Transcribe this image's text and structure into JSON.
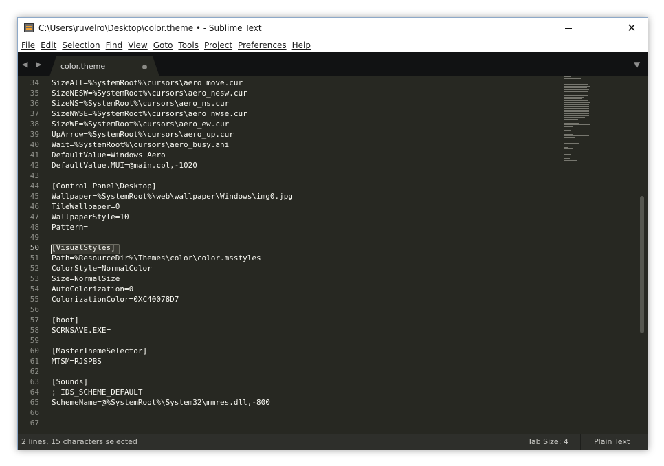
{
  "window": {
    "title": "C:\\Users\\ruvelro\\Desktop\\color.theme • - Sublime Text",
    "close_glyph": "✕"
  },
  "menu": [
    "File",
    "Edit",
    "Selection",
    "Find",
    "View",
    "Goto",
    "Tools",
    "Project",
    "Preferences",
    "Help"
  ],
  "tabbar": {
    "nav": "◀ ▶",
    "dropdown": "▼",
    "tabs": [
      {
        "label": "color.theme",
        "dirty": true
      }
    ]
  },
  "editor": {
    "current_line": 50,
    "lines": [
      {
        "no": "34",
        "text": "SizeAll=%SystemRoot%\\cursors\\aero_move.cur"
      },
      {
        "no": "35",
        "text": "SizeNESW=%SystemRoot%\\cursors\\aero_nesw.cur"
      },
      {
        "no": "36",
        "text": "SizeNS=%SystemRoot%\\cursors\\aero_ns.cur"
      },
      {
        "no": "37",
        "text": "SizeNWSE=%SystemRoot%\\cursors\\aero_nwse.cur"
      },
      {
        "no": "38",
        "text": "SizeWE=%SystemRoot%\\cursors\\aero_ew.cur"
      },
      {
        "no": "39",
        "text": "UpArrow=%SystemRoot%\\cursors\\aero_up.cur"
      },
      {
        "no": "40",
        "text": "Wait=%SystemRoot%\\cursors\\aero_busy.ani"
      },
      {
        "no": "41",
        "text": "DefaultValue=Windows Aero"
      },
      {
        "no": "42",
        "text": "DefaultValue.MUI=@main.cpl,-1020"
      },
      {
        "no": "43",
        "text": ""
      },
      {
        "no": "44",
        "text": "[Control Panel\\Desktop]"
      },
      {
        "no": "45",
        "text": "Wallpaper=%SystemRoot%\\web\\wallpaper\\Windows\\img0.jpg"
      },
      {
        "no": "46",
        "text": "TileWallpaper=0"
      },
      {
        "no": "47",
        "text": "WallpaperStyle=10"
      },
      {
        "no": "48",
        "text": "Pattern="
      },
      {
        "no": "49",
        "text": ""
      },
      {
        "no": "50",
        "text": "[VisualStyles]"
      },
      {
        "no": "51",
        "text": "Path=%ResourceDir%\\Themes\\color\\color.msstyles"
      },
      {
        "no": "52",
        "text": "ColorStyle=NormalColor"
      },
      {
        "no": "53",
        "text": "Size=NormalSize"
      },
      {
        "no": "54",
        "text": "AutoColorization=0"
      },
      {
        "no": "55",
        "text": "ColorizationColor=0XC40078D7"
      },
      {
        "no": "56",
        "text": ""
      },
      {
        "no": "57",
        "text": "[boot]"
      },
      {
        "no": "58",
        "text": "SCRNSAVE.EXE="
      },
      {
        "no": "59",
        "text": ""
      },
      {
        "no": "60",
        "text": "[MasterThemeSelector]"
      },
      {
        "no": "61",
        "text": "MTSM=RJSPBS"
      },
      {
        "no": "62",
        "text": ""
      },
      {
        "no": "63",
        "text": "[Sounds]"
      },
      {
        "no": "64",
        "text": "; IDS_SCHEME_DEFAULT"
      },
      {
        "no": "65",
        "text": "SchemeName=@%SystemRoot%\\System32\\mmres.dll,-800"
      },
      {
        "no": "66",
        "text": ""
      },
      {
        "no": "67",
        "text": ""
      }
    ]
  },
  "statusbar": {
    "selection": "2 lines, 15 characters selected",
    "tab_size": "Tab Size: 4",
    "syntax": "Plain Text"
  },
  "colors": {
    "editor_bg": "#272822",
    "tabbar_bg": "#111213",
    "text": "#f8f8f2",
    "gutter_text": "#8f908a",
    "statusbar_bg": "#2e2f2b"
  }
}
